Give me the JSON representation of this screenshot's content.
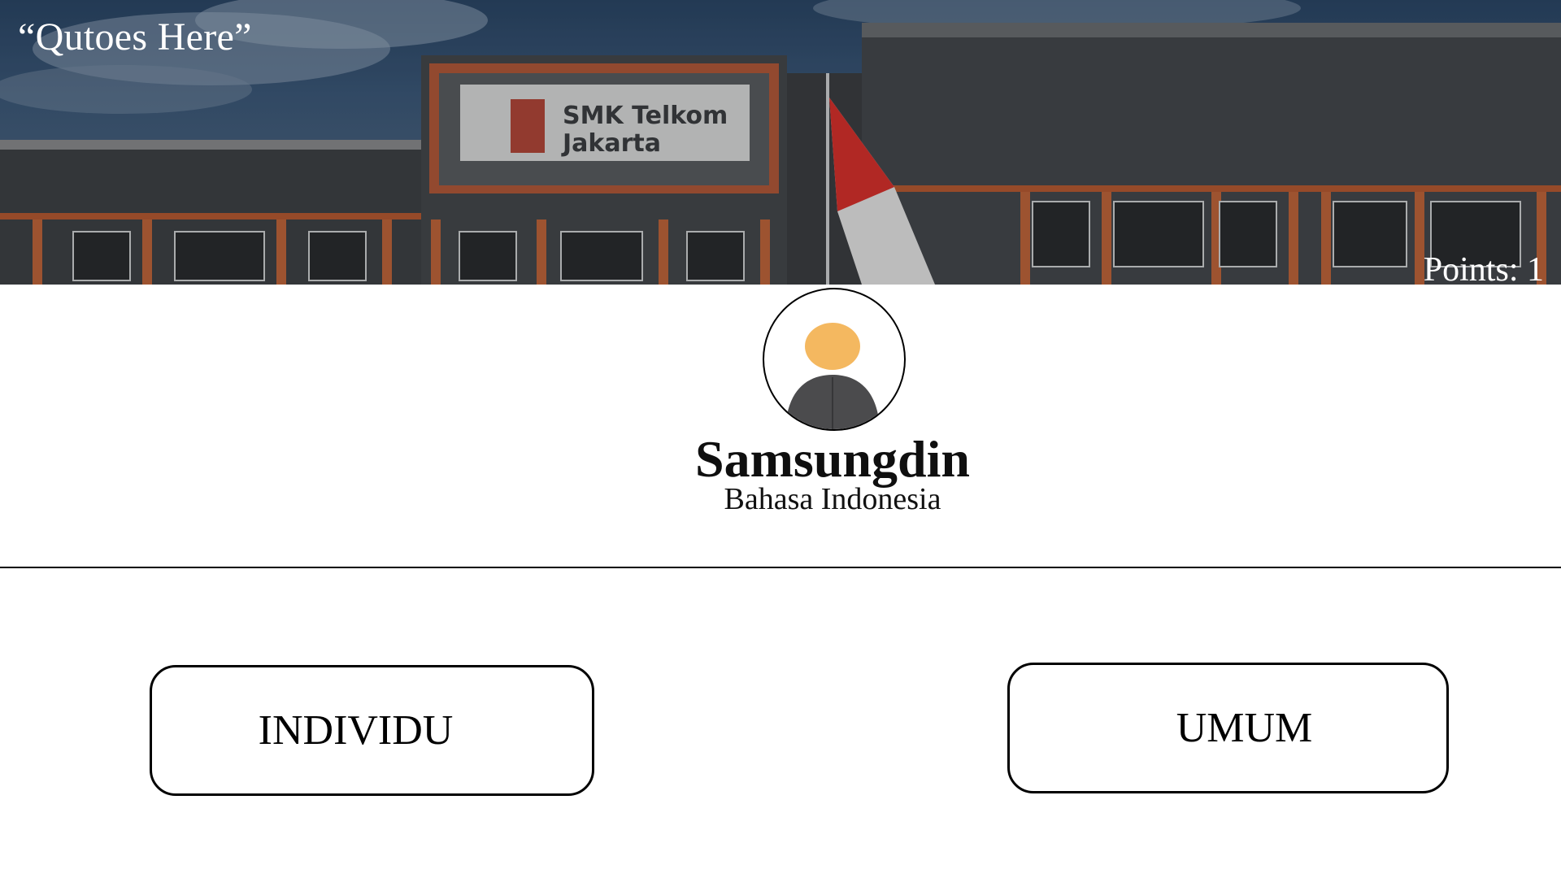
{
  "header": {
    "quote": "“Qutoes Here”",
    "points_text": "Points: 1",
    "banner_sign_line1": "SMK Telkom",
    "banner_sign_line2": "Jakarta"
  },
  "profile": {
    "name": "Samsungdin",
    "subject": "Bahasa Indonesia",
    "avatar_icon": "person-avatar-icon"
  },
  "modes": {
    "individu_label": "INDIVIDU",
    "umum_label": "UMUM"
  },
  "colors": {
    "avatar_head": "#f4b860",
    "avatar_body": "#4b4b4d",
    "flag_red": "#d8312c",
    "building_accent": "#c8643a"
  }
}
